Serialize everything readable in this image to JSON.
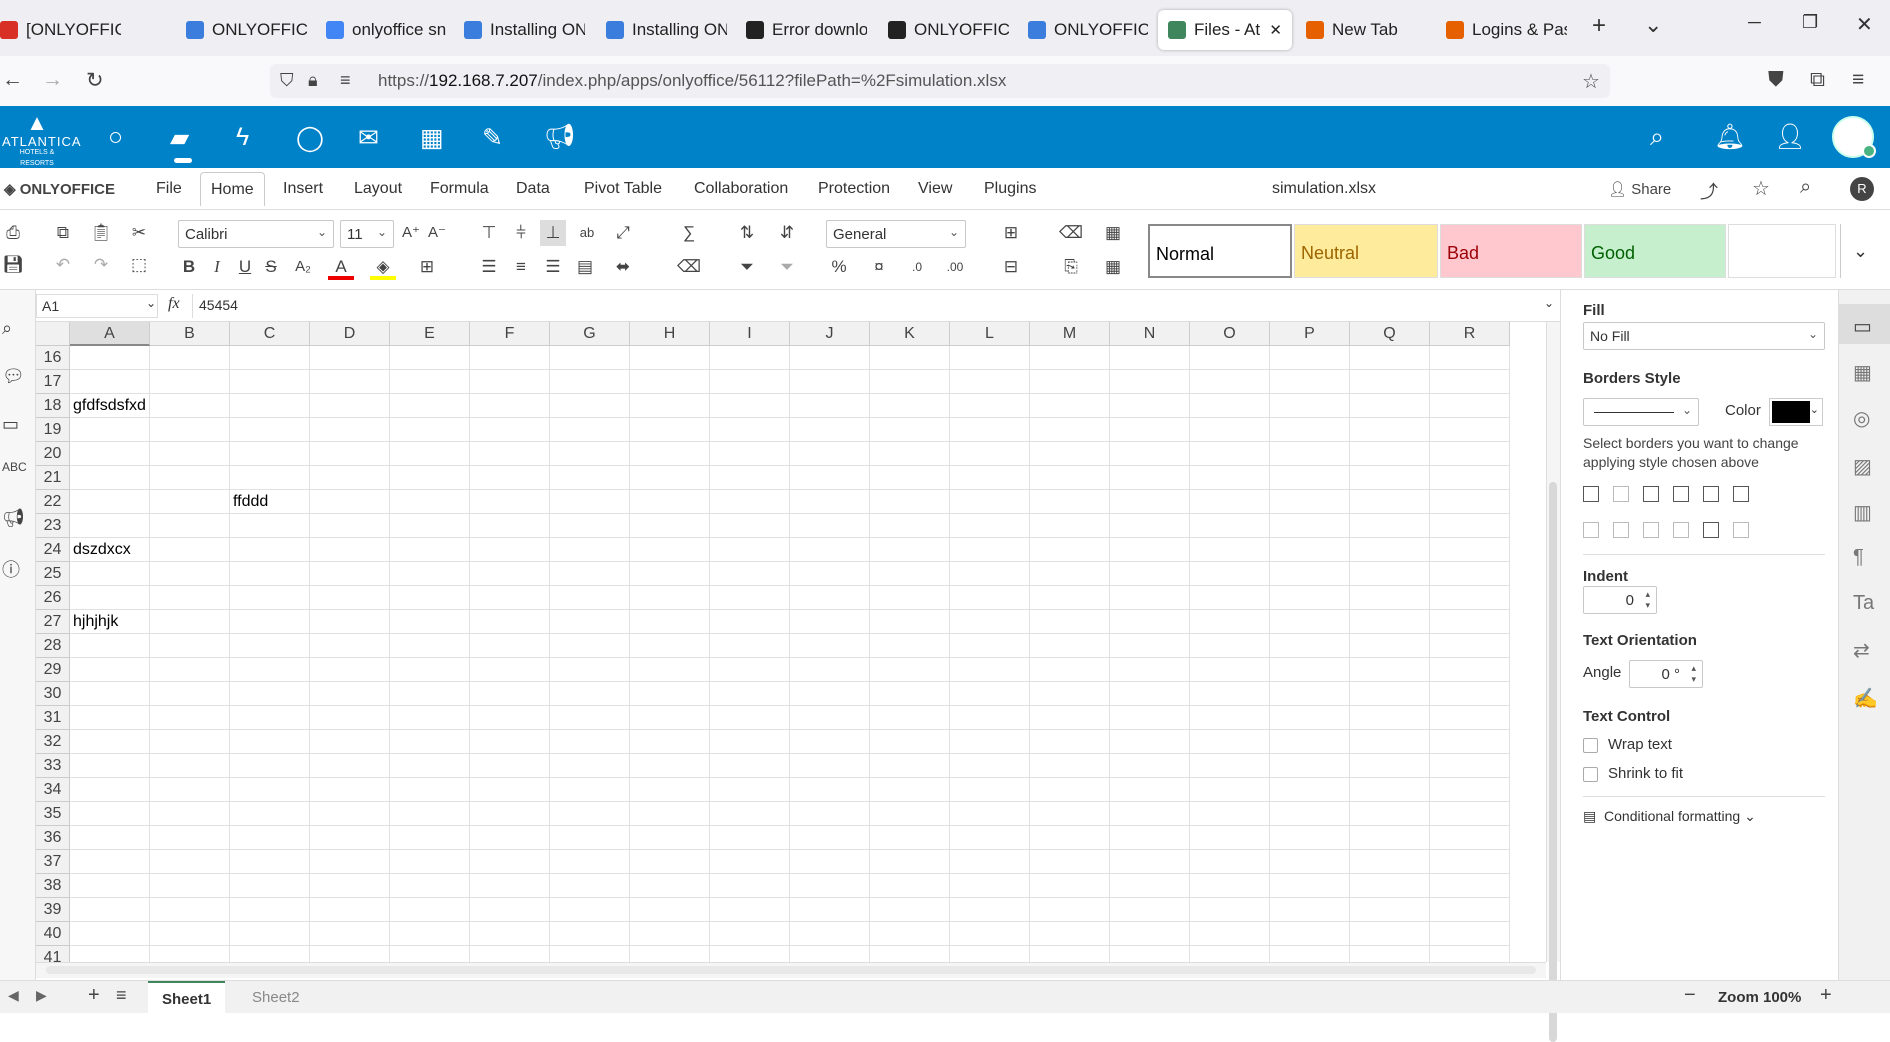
{
  "browser": {
    "tabs": [
      {
        "title": "[ONLYOFFICE",
        "icon": "gmail-icon",
        "color": "#d93025"
      },
      {
        "title": "ONLYOFFICE",
        "icon": "onlyoffice-icon",
        "color": "#3b7ddd"
      },
      {
        "title": "onlyoffice sn",
        "icon": "google-icon",
        "color": "#4285f4"
      },
      {
        "title": "Installing ON",
        "icon": "onlyoffice-icon",
        "color": "#3b7ddd"
      },
      {
        "title": "Installing ON",
        "icon": "onlyoffice-icon",
        "color": "#3b7ddd"
      },
      {
        "title": "Error downlo",
        "icon": "github-icon",
        "color": "#222222"
      },
      {
        "title": "ONLYOFFICE/",
        "icon": "github-icon",
        "color": "#222222"
      },
      {
        "title": "ONLYOFFICE",
        "icon": "onlyoffice-icon",
        "color": "#3b7ddd"
      },
      {
        "title": "Files - Atla",
        "icon": "sheet-icon",
        "color": "#40865c",
        "active": true
      },
      {
        "title": "New Tab",
        "icon": "firefox-icon",
        "color": "#e66000"
      },
      {
        "title": "Logins & Pas",
        "icon": "firefox-icon",
        "color": "#e66000"
      }
    ],
    "url_prefix": "https://",
    "url_host": "192.168.7.207",
    "url_path": "/index.php/apps/onlyoffice/56112?filePath=%2Fsimulation.xlsx"
  },
  "app": {
    "logo_text": "ATLANTICA",
    "logo_sub": "HOTELS & RESORTS"
  },
  "editor": {
    "brand": "ONLYOFFICE",
    "menus": [
      "File",
      "Home",
      "Insert",
      "Layout",
      "Formula",
      "Data",
      "Pivot Table",
      "Collaboration",
      "Protection",
      "View",
      "Plugins"
    ],
    "active_menu": "Home",
    "file_name": "simulation.xlsx",
    "share_label": "Share",
    "user_initial": "R",
    "font_name": "Calibri",
    "font_size": "11",
    "number_format": "General",
    "styles": [
      {
        "label": "Normal",
        "bg": "#ffffff",
        "fg": "#000000"
      },
      {
        "label": "Neutral",
        "bg": "#ffeb9c",
        "fg": "#9c6500"
      },
      {
        "label": "Bad",
        "bg": "#ffc7ce",
        "fg": "#9c0006"
      },
      {
        "label": "Good",
        "bg": "#c6efce",
        "fg": "#006100"
      },
      {
        "label": "",
        "bg": "#ffffff",
        "fg": "#000000"
      }
    ],
    "cell_ref": "A1",
    "fx": "fx",
    "formula": "45454"
  },
  "sheet": {
    "columns": [
      "A",
      "B",
      "C",
      "D",
      "E",
      "F",
      "G",
      "H",
      "I",
      "J",
      "K",
      "L",
      "M",
      "N",
      "O",
      "P",
      "Q",
      "R"
    ],
    "rows": [
      {
        "n": "16",
        "cells": {}
      },
      {
        "n": "17",
        "cells": {}
      },
      {
        "n": "18",
        "cells": {
          "A": "gfdfsdsfxd"
        }
      },
      {
        "n": "19",
        "cells": {}
      },
      {
        "n": "20",
        "cells": {}
      },
      {
        "n": "21",
        "cells": {}
      },
      {
        "n": "22",
        "cells": {
          "C": "ffddd"
        }
      },
      {
        "n": "23",
        "cells": {}
      },
      {
        "n": "24",
        "cells": {
          "A": "dszdxcx"
        }
      },
      {
        "n": "25",
        "cells": {}
      },
      {
        "n": "26",
        "cells": {}
      },
      {
        "n": "27",
        "cells": {
          "A": "hjhjhjk"
        }
      },
      {
        "n": "28",
        "cells": {}
      },
      {
        "n": "29",
        "cells": {}
      },
      {
        "n": "30",
        "cells": {}
      },
      {
        "n": "31",
        "cells": {}
      },
      {
        "n": "32",
        "cells": {}
      },
      {
        "n": "33",
        "cells": {}
      },
      {
        "n": "34",
        "cells": {}
      },
      {
        "n": "35",
        "cells": {}
      },
      {
        "n": "36",
        "cells": {}
      },
      {
        "n": "37",
        "cells": {}
      },
      {
        "n": "38",
        "cells": {}
      },
      {
        "n": "39",
        "cells": {}
      },
      {
        "n": "40",
        "cells": {}
      },
      {
        "n": "41",
        "cells": {}
      }
    ],
    "tabs": [
      "Sheet1",
      "Sheet2"
    ],
    "active_tab": "Sheet1",
    "zoom": "Zoom 100%"
  },
  "panel": {
    "fill_label": "Fill",
    "fill_value": "No Fill",
    "borders_label": "Borders Style",
    "color_label": "Color",
    "border_color": "#000000",
    "borders_hint": "Select borders you want to change applying style chosen above",
    "indent_label": "Indent",
    "indent_value": "0",
    "orientation_label": "Text Orientation",
    "angle_label": "Angle",
    "angle_value": "0 °",
    "text_control_label": "Text Control",
    "wrap_label": "Wrap text",
    "shrink_label": "Shrink to fit",
    "cond_label": "Conditional formatting"
  }
}
